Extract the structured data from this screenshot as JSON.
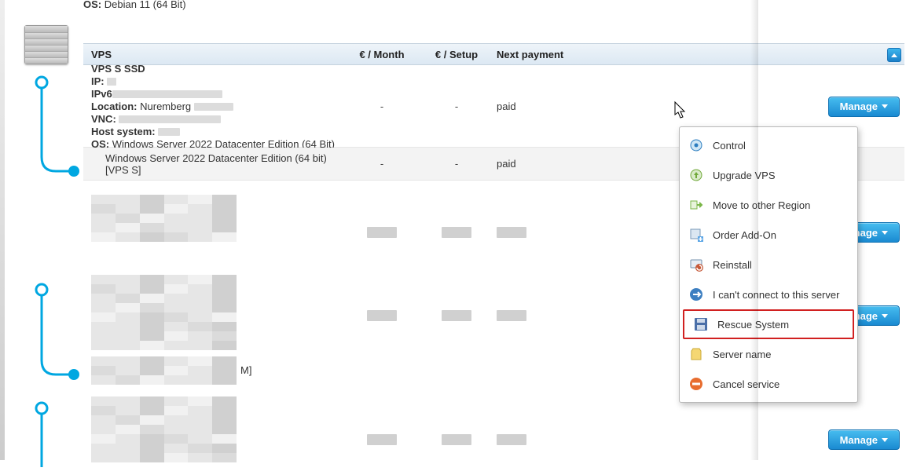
{
  "top_os_label": "OS:",
  "top_os_value": "Debian 11 (64 Bit)",
  "columns": {
    "vps": "VPS",
    "month": "€ / Month",
    "setup": "€ / Setup",
    "next": "Next payment"
  },
  "vps_detail": {
    "name": "VPS S SSD",
    "ip_label": "IP:",
    "ipv6_label": "IPv6",
    "location_label": "Location:",
    "location_value": "Nuremberg",
    "vnc_label": "VNC:",
    "host_label": "Host system:",
    "os_label": "OS:",
    "os_value": "Windows Server 2022 Datacenter Edition (64 Bit)",
    "month": "-",
    "setup": "-",
    "next": "paid"
  },
  "subrow": {
    "name": "Windows Server 2022 Datacenter Edition (64 bit) [VPS S]",
    "month": "-",
    "setup": "-",
    "next": "paid"
  },
  "suffix_letter": "M]",
  "manage_label": "Manage",
  "menu": {
    "control": "Control",
    "upgrade": "Upgrade VPS",
    "move": "Move to other Region",
    "addon": "Order Add-On",
    "reinstall": "Reinstall",
    "cant": "I can't connect to this server",
    "rescue": "Rescue System",
    "servername": "Server name",
    "cancel": "Cancel service"
  }
}
